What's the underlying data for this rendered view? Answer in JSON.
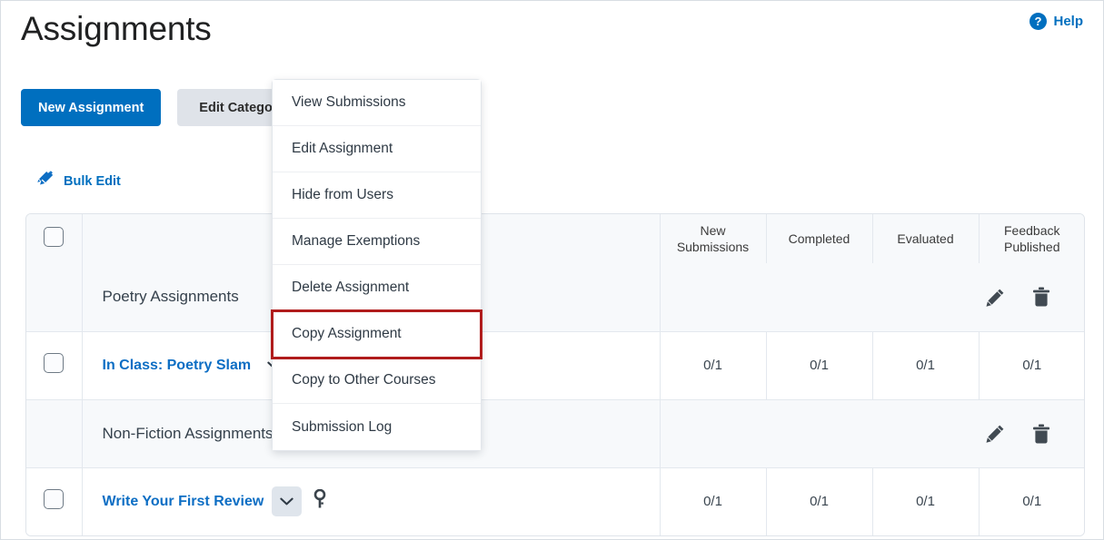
{
  "header": {
    "title": "Assignments",
    "help_label": "Help",
    "help_icon": "question-circle-icon"
  },
  "toolbar": {
    "new_assignment_label": "New Assignment",
    "edit_categories_label": "Edit Categories",
    "bulk_edit_label": "Bulk Edit",
    "bulk_edit_icon": "pencil-edit-icon"
  },
  "table": {
    "columns": [
      {
        "key": "check",
        "label": ""
      },
      {
        "key": "name",
        "label": ""
      },
      {
        "key": "new_submissions",
        "label": "New\nSubmissions"
      },
      {
        "key": "completed",
        "label": "Completed"
      },
      {
        "key": "evaluated",
        "label": "Evaluated"
      },
      {
        "key": "feedback_published",
        "label": "Feedback\nPublished"
      }
    ],
    "header_labels": {
      "new_submissions_line1": "New",
      "new_submissions_line2": "Submissions",
      "completed": "Completed",
      "evaluated": "Evaluated",
      "feedback_published_line1": "Feedback",
      "feedback_published_line2": "Published"
    },
    "rows": [
      {
        "type": "category",
        "name": "Poetry Assignments",
        "new_submissions": "",
        "completed": "",
        "evaluated": "",
        "feedback_published": "",
        "actions": [
          "pencil-icon",
          "trash-icon"
        ]
      },
      {
        "type": "assignment",
        "name": "In Class: Poetry Slam",
        "new_submissions": "0/1",
        "completed": "0/1",
        "evaluated": "0/1",
        "feedback_published": "0/1",
        "has_chevron": true,
        "has_key_icon": false
      },
      {
        "type": "category",
        "name": "Non-Fiction Assignments",
        "new_submissions": "",
        "completed": "",
        "evaluated": "",
        "feedback_published": "",
        "actions": [
          "pencil-icon",
          "trash-icon"
        ]
      },
      {
        "type": "assignment",
        "name": "Write Your First Review",
        "new_submissions": "0/1",
        "completed": "0/1",
        "evaluated": "0/1",
        "feedback_published": "0/1",
        "has_chevron": true,
        "has_key_icon": true
      }
    ]
  },
  "context_menu": {
    "items": [
      {
        "label": "View Submissions",
        "highlighted": false
      },
      {
        "label": "Edit Assignment",
        "highlighted": false
      },
      {
        "label": "Hide from Users",
        "highlighted": false
      },
      {
        "label": "Manage Exemptions",
        "highlighted": false
      },
      {
        "label": "Delete Assignment",
        "highlighted": false
      },
      {
        "label": "Copy Assignment",
        "highlighted": true
      },
      {
        "label": "Copy to Other Courses",
        "highlighted": false
      },
      {
        "label": "Submission Log",
        "highlighted": false
      }
    ]
  },
  "colors": {
    "accent_blue": "#006fbf",
    "link_blue": "#0d6ec4",
    "highlight_red": "#b01c1c",
    "row_alt": "#f7f9fb"
  }
}
